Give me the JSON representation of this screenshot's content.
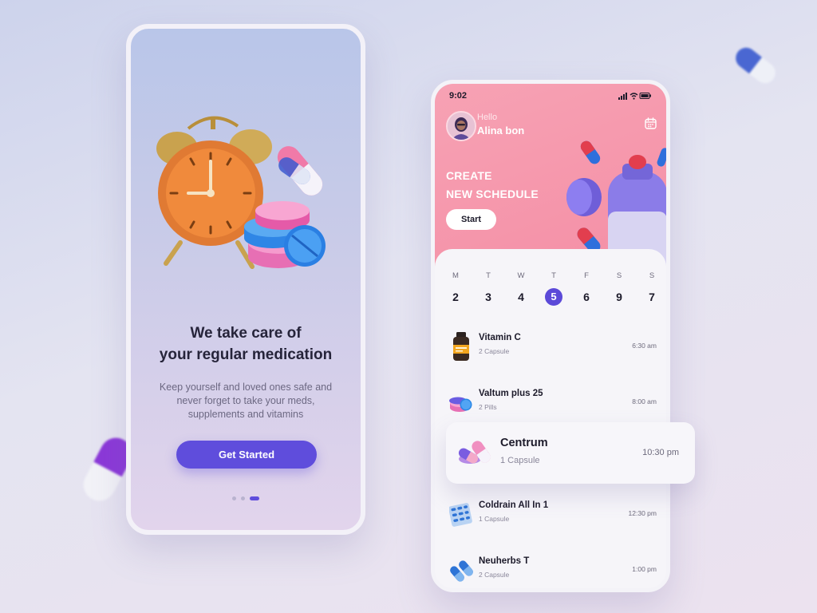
{
  "colors": {
    "accent": "#5f4ddc",
    "header_pink": "#f48ea5",
    "text_dark": "#1c1a2a"
  },
  "onboarding": {
    "title_line1": "We take care of",
    "title_line2": "your regular medication",
    "description": "Keep yourself and loved ones safe and never forget to take your meds, supplements and vitamins",
    "cta_label": "Get Started",
    "page_count": 3,
    "active_page": 3
  },
  "app": {
    "status_time": "9:02",
    "greeting": "Hello",
    "user_name": "Alina bon",
    "banner_line1": "CREATE",
    "banner_line2": "NEW SCHEDULE",
    "start_label": "Start",
    "week": [
      {
        "letter": "M",
        "num": "2"
      },
      {
        "letter": "T",
        "num": "3"
      },
      {
        "letter": "W",
        "num": "4"
      },
      {
        "letter": "T",
        "num": "5",
        "selected": true
      },
      {
        "letter": "F",
        "num": "6"
      },
      {
        "letter": "S",
        "num": "9"
      },
      {
        "letter": "S",
        "num": "7"
      }
    ],
    "medications": [
      {
        "name": "Vitamin C",
        "dose": "2 Capsule",
        "time": "6:30 am",
        "icon": "vitamin-bottle-icon"
      },
      {
        "name": "Valtum plus 25",
        "dose": "2 Pills",
        "time": "8:00 am",
        "icon": "pill-stack-icon"
      },
      {
        "name": "Centrum",
        "dose": "1 Capsule",
        "time": "10:30 pm",
        "icon": "capsules-icon",
        "highlighted": true
      },
      {
        "name": "Coldrain All In 1",
        "dose": "1 Capsule",
        "time": "12:30 pm",
        "icon": "blister-pack-icon"
      },
      {
        "name": "Neuherbs T",
        "dose": "2 Capsule",
        "time": "1:00 pm",
        "icon": "capsule-pair-icon"
      }
    ]
  }
}
